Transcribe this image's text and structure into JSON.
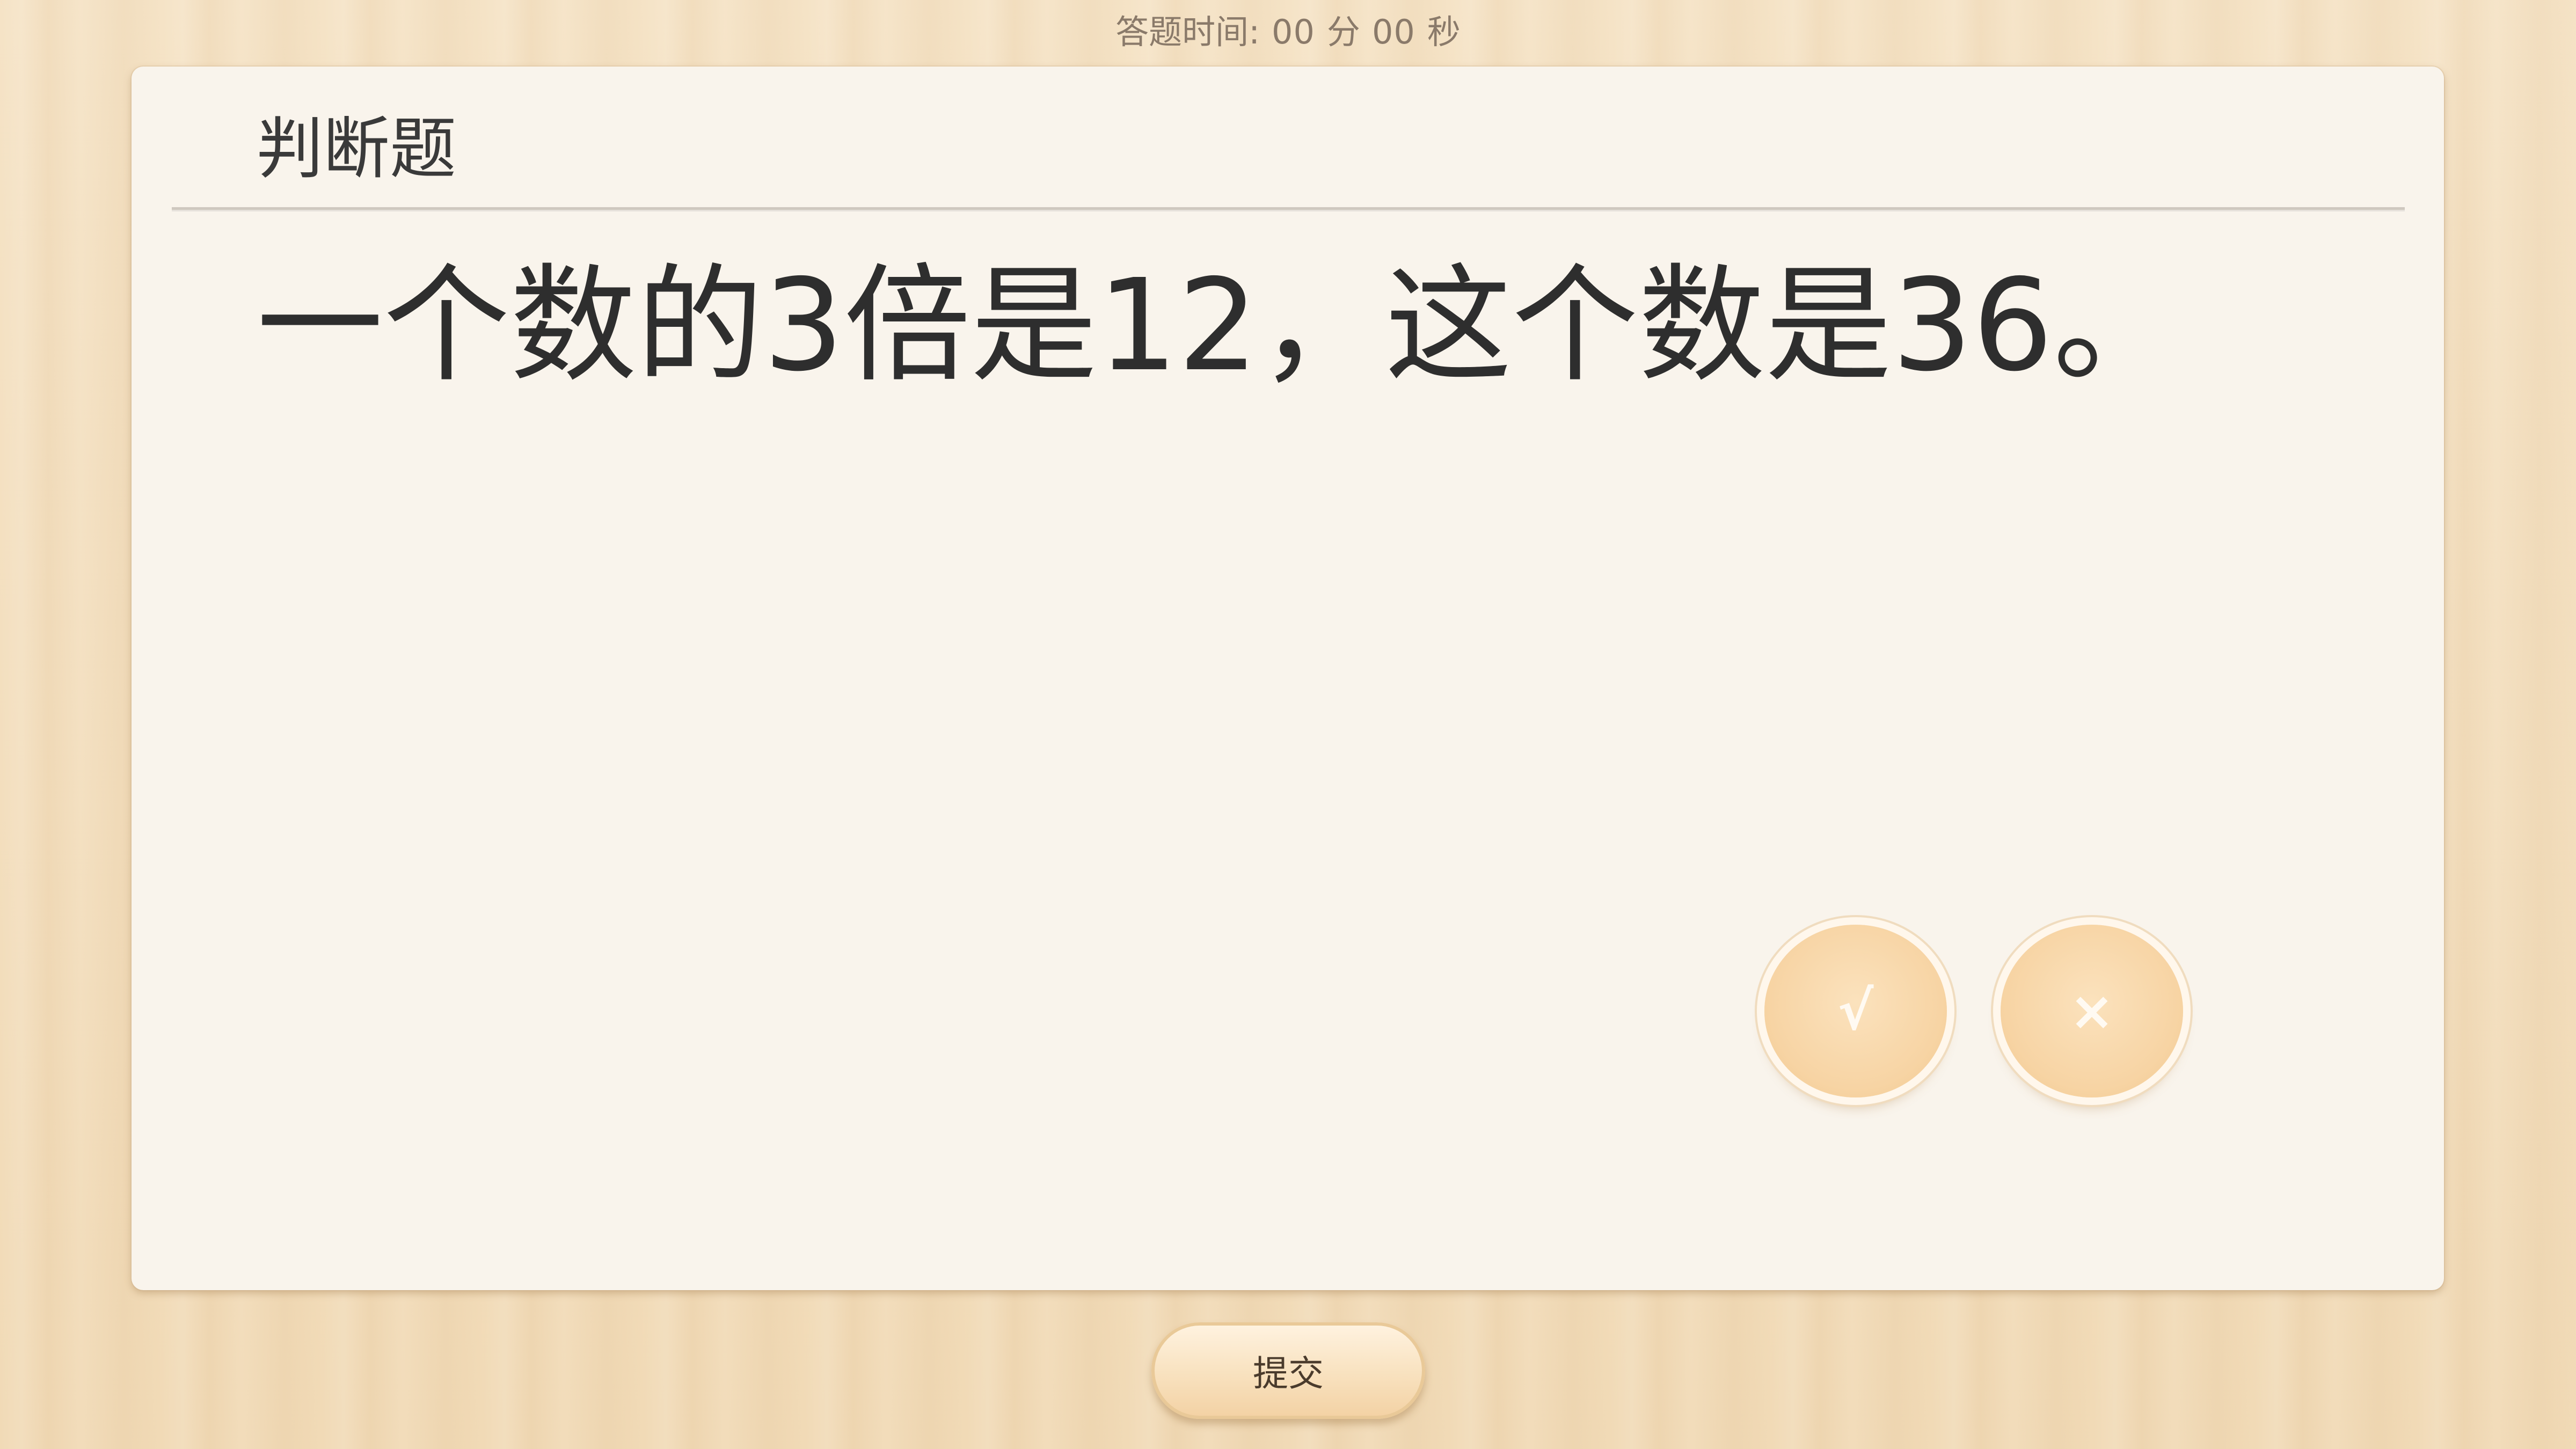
{
  "timer": {
    "label": "答题时间:",
    "minutes": "00",
    "minutes_unit": "分",
    "seconds": "00",
    "seconds_unit": "秒"
  },
  "card": {
    "question_type": "判断题",
    "question_text": "一个数的3倍是12，这个数是36。"
  },
  "answers": {
    "true_symbol": "√",
    "false_symbol": "×"
  },
  "footer": {
    "submit_label": "提交"
  }
}
